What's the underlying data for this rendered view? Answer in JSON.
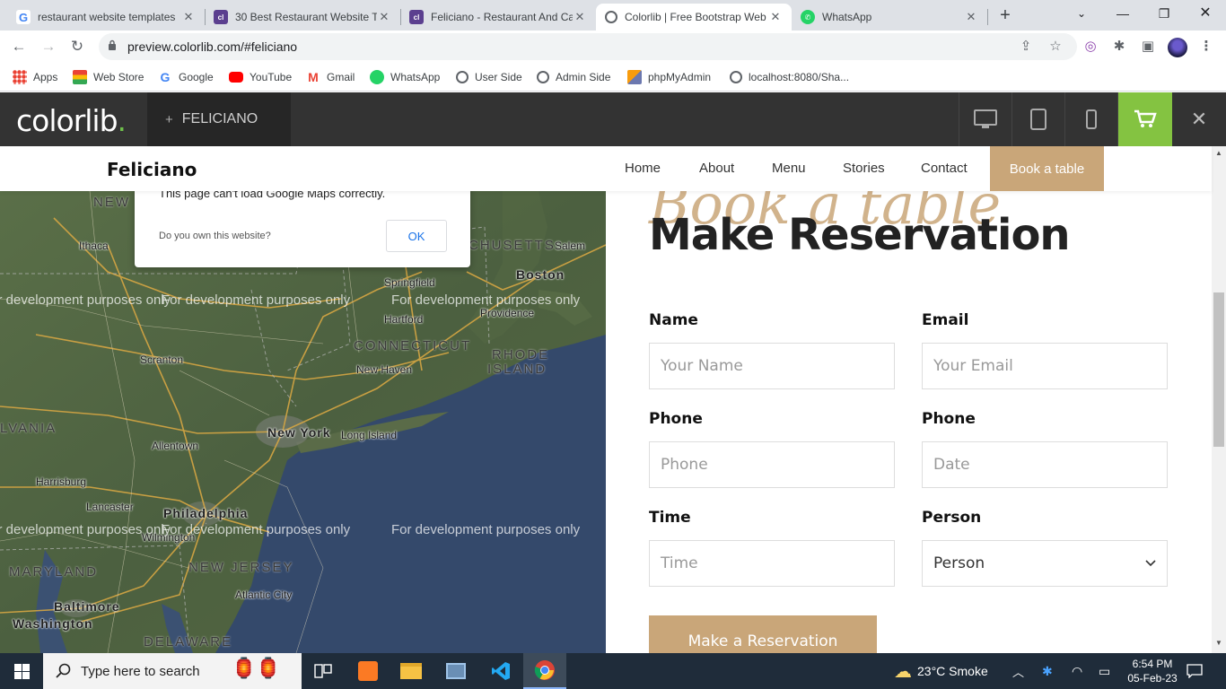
{
  "browser": {
    "tabs": [
      {
        "title": "restaurant website templates",
        "favicon": "google-icon"
      },
      {
        "title": "30 Best Restaurant Website T",
        "favicon": "colorlib-icon"
      },
      {
        "title": "Feliciano - Restaurant And Ca",
        "favicon": "colorlib-icon"
      },
      {
        "title": "Colorlib | Free Bootstrap Web",
        "favicon": "colorlib-icon",
        "active": true
      },
      {
        "title": "WhatsApp",
        "favicon": "whatsapp-icon"
      }
    ],
    "url": "preview.colorlib.com/#feliciano",
    "bookmarks": [
      {
        "label": "Apps",
        "icon": "apps-grid-icon"
      },
      {
        "label": "Web Store",
        "icon": "web-store-icon"
      },
      {
        "label": "Google",
        "icon": "google-icon"
      },
      {
        "label": "YouTube",
        "icon": "youtube-icon"
      },
      {
        "label": "Gmail",
        "icon": "gmail-icon"
      },
      {
        "label": "WhatsApp",
        "icon": "whatsapp-icon"
      },
      {
        "label": "User Side",
        "icon": "globe-icon"
      },
      {
        "label": "Admin Side",
        "icon": "admin-icon"
      },
      {
        "label": "phpMyAdmin",
        "icon": "phpmyadmin-icon"
      },
      {
        "label": "localhost:8080/Sha...",
        "icon": "globe-icon"
      }
    ]
  },
  "preview_bar": {
    "logo": "colorlib",
    "logo_dot": ".",
    "theme_plus": "+",
    "theme_name": "FELICIANO",
    "accent": "#84c341"
  },
  "site": {
    "brand": "Feliciano",
    "nav": [
      "Home",
      "About",
      "Menu",
      "Stories",
      "Contact"
    ],
    "book_button": "Book a table",
    "accent": "#c9a679"
  },
  "map": {
    "dialog_message": "This page can't load Google Maps correctly.",
    "dialog_question": "Do you own this website?",
    "dialog_ok": "OK",
    "watermark": "For development purposes only",
    "labels": {
      "new": "NEW",
      "ithaca": "Ithaca",
      "massachusetts": "CHUSETTS",
      "salem": "Salem",
      "boston": "Boston",
      "springfield": "Springfield",
      "providence": "Providence",
      "hartford": "Hartford",
      "connecticut": "CONNECTICUT",
      "rhode": "RHODE",
      "island": "ISLAND",
      "scranton": "Scranton",
      "new_haven": "New Haven",
      "pennsylvania": "LVANIA",
      "allentown": "Allentown",
      "new_york": "New York",
      "long_island": "Long Island",
      "harrisburg": "Harrisburg",
      "lancaster": "Lancaster",
      "philadelphia": "Philadelphia",
      "wilmington": "Wilmington",
      "maryland": "MARYLAND",
      "new_jersey": "NEW JERSEY",
      "atlantic_city": "Atlantic City",
      "baltimore": "Baltimore",
      "washington": "Washington",
      "delaware": "DELAWARE"
    }
  },
  "reservation": {
    "script_title": "Book a table",
    "title": "Make Reservation",
    "fields": [
      {
        "label": "Name",
        "placeholder": "Your Name"
      },
      {
        "label": "Email",
        "placeholder": "Your Email"
      },
      {
        "label": "Phone",
        "placeholder": "Phone"
      },
      {
        "label": "Phone",
        "placeholder": "Date"
      },
      {
        "label": "Time",
        "placeholder": "Time"
      },
      {
        "label": "Person",
        "value": "Person"
      }
    ],
    "submit": "Make a Reservation"
  },
  "taskbar": {
    "search_placeholder": "Type here to search",
    "weather": "23°C  Smoke",
    "time": "6:54 PM",
    "date": "05-Feb-23"
  }
}
